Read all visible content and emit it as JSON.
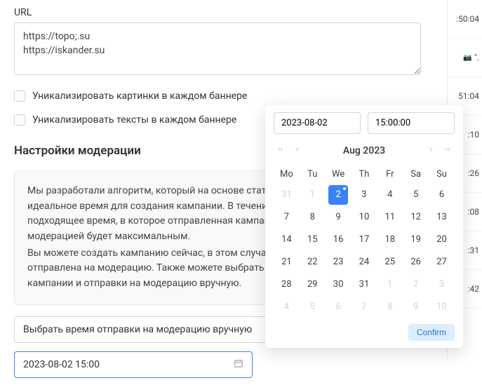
{
  "url_section": {
    "label": "URL",
    "value": "https://topo;.su\nhttps://iskander.su"
  },
  "checkboxes": {
    "unique_images": {
      "label": "Уникализировать картинки в каждом баннере"
    },
    "unique_texts": {
      "label": "Уникализировать тексты в каждом баннере"
    }
  },
  "moderation": {
    "title": "Настройки модерации",
    "info_p1": "Мы разработали алгоритм, который на основе статистики модерации подбирает идеальное время для создания кампании. В течение 16 часов будет выбрано подходящее время, в которое отправленная кампания будет принятым модерацией будет максимальным.",
    "info_p2": "Вы можете создать кампанию сейчас, в этом случае она будет сразу же отправлена на модерацию. Также можете выбрать время для создания кампании и отправки на модерацию вручную.",
    "select_label": "Выбрать время отправки на модерацию вручную",
    "datetime_value": "2023-08-02 15:00"
  },
  "calendar": {
    "date_input": "2023-08-02",
    "time_input": "15:00:00",
    "month_label": "Aug 2023",
    "weekdays": [
      "Mo",
      "Tu",
      "We",
      "Th",
      "Fr",
      "Sa",
      "Su"
    ],
    "weeks": [
      [
        {
          "d": 31,
          "muted": true
        },
        {
          "d": 1,
          "muted": true
        },
        {
          "d": 2,
          "selected": true,
          "dot": true
        },
        {
          "d": 3
        },
        {
          "d": 4
        },
        {
          "d": 5
        },
        {
          "d": 6
        }
      ],
      [
        {
          "d": 7
        },
        {
          "d": 8
        },
        {
          "d": 9
        },
        {
          "d": 10
        },
        {
          "d": 11
        },
        {
          "d": 12
        },
        {
          "d": 13
        }
      ],
      [
        {
          "d": 14
        },
        {
          "d": 15
        },
        {
          "d": 16
        },
        {
          "d": 17
        },
        {
          "d": 18
        },
        {
          "d": 19
        },
        {
          "d": 20
        }
      ],
      [
        {
          "d": 21
        },
        {
          "d": 22
        },
        {
          "d": 23
        },
        {
          "d": 24
        },
        {
          "d": 25
        },
        {
          "d": 26
        },
        {
          "d": 27
        }
      ],
      [
        {
          "d": 28
        },
        {
          "d": 29
        },
        {
          "d": 30
        },
        {
          "d": 31
        },
        {
          "d": 1,
          "muted": true
        },
        {
          "d": 2,
          "muted": true
        },
        {
          "d": 3,
          "muted": true
        }
      ],
      [
        {
          "d": 4,
          "muted": true
        },
        {
          "d": 5,
          "muted": true
        },
        {
          "d": 6,
          "muted": true
        },
        {
          "d": 7,
          "muted": true
        },
        {
          "d": 8,
          "muted": true
        },
        {
          "d": 9,
          "muted": true
        },
        {
          "d": 10,
          "muted": true
        }
      ]
    ],
    "confirm_label": "Confirm"
  },
  "bg_times": {
    "items": [
      {
        "text": ":50:04",
        "icon": ""
      },
      {
        "text": "\".",
        "icon": "cam"
      },
      {
        "text": "51:04",
        "icon": ""
      },
      {
        "text": ":10",
        "icon": ""
      },
      {
        "text": ":26",
        "icon": ""
      },
      {
        "text": ":08",
        "icon": ""
      },
      {
        "text": ":31",
        "icon": ""
      },
      {
        "text": ":42",
        "icon": ""
      }
    ]
  }
}
